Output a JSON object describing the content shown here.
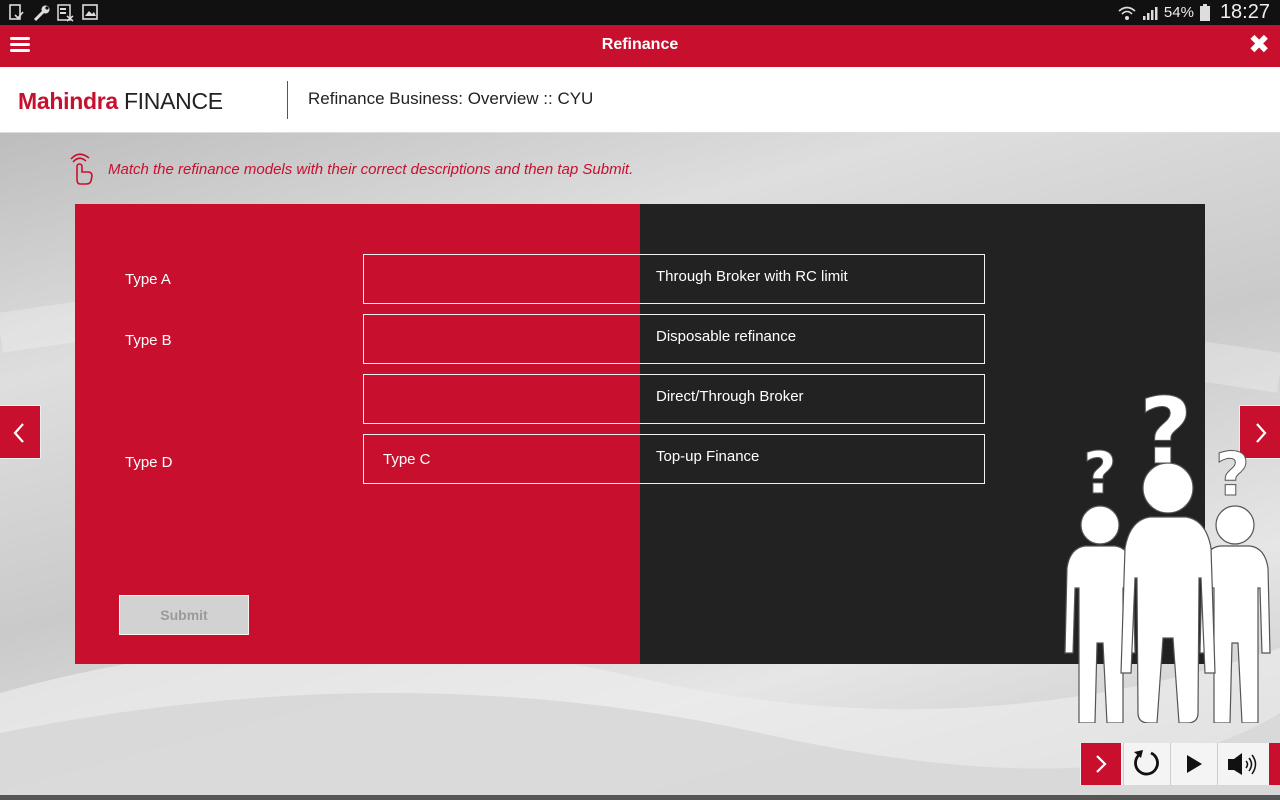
{
  "status_bar": {
    "battery": "54%",
    "clock": "18:27",
    "icons": [
      "sim-card-icon",
      "wrench-icon",
      "storage-icon",
      "image-icon",
      "wifi-icon",
      "signal-icon",
      "battery-icon"
    ]
  },
  "app_bar": {
    "title": "Refinance",
    "menu_icon": "hamburger-menu-icon",
    "close_icon": "close-icon"
  },
  "header": {
    "logo_brand": "Mahindra",
    "logo_finance": "FINANCE",
    "course_title": "Refinance Business: Overview :: CYU"
  },
  "instruction": {
    "text": "Match the refinance models with their correct descriptions and then tap Submit.",
    "icon": "tap-hand-icon"
  },
  "activity": {
    "types": [
      "Type A",
      "Type B",
      "Type D"
    ],
    "drop_slots": [
      "",
      "",
      "",
      "Type C"
    ],
    "descriptions": [
      "Through Broker with RC limit",
      "Disposable refinance",
      "Direct/Through Broker",
      "Top-up Finance"
    ],
    "submit_label": "Submit"
  },
  "navigation": {
    "prev_icon": "chevron-left-icon",
    "next_icon": "chevron-right-icon"
  },
  "controls": {
    "icons": [
      "chevron-right-icon",
      "replay-icon",
      "play-icon",
      "audio-icon"
    ]
  },
  "colors": {
    "brand_red": "#c8102e",
    "panel_dark": "#222222",
    "submit_disabled": "#d2d2d2"
  }
}
